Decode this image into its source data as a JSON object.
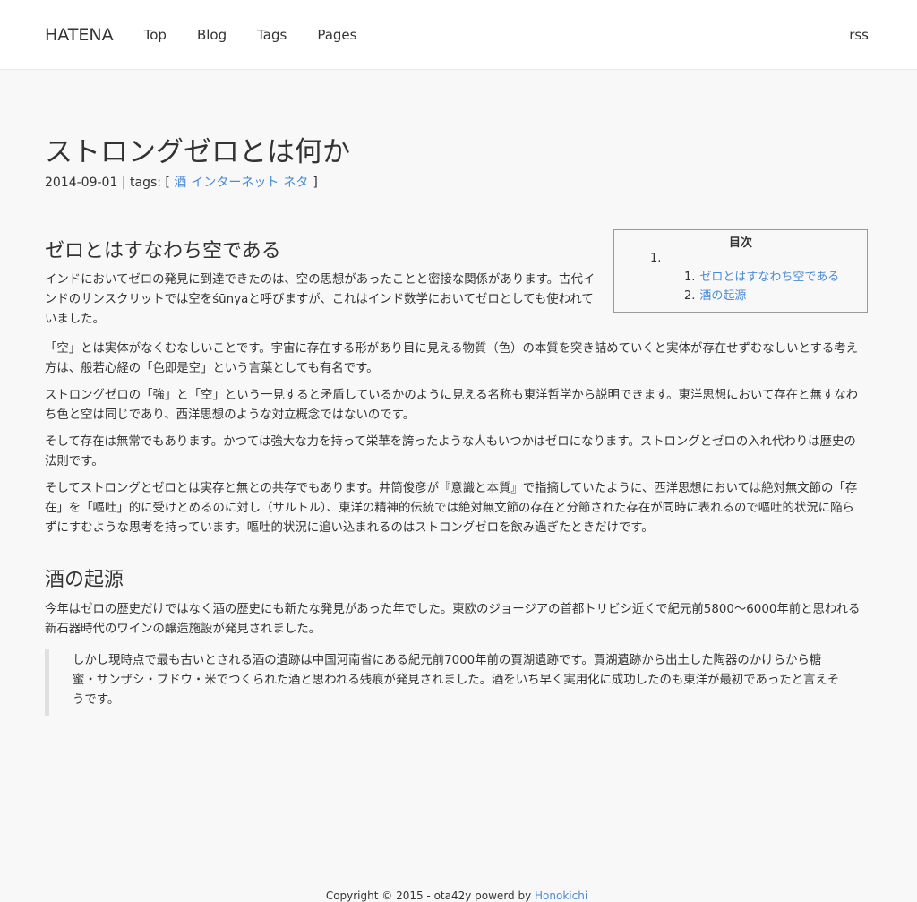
{
  "nav": {
    "brand": "HATENA",
    "items": [
      "Top",
      "Blog",
      "Tags",
      "Pages"
    ],
    "rss": "rss"
  },
  "post": {
    "title": "ストロングゼロとは何か",
    "date": "2014-09-01",
    "tags_prefix": "| tags: [",
    "tags": [
      "酒",
      "インターネット",
      "ネタ"
    ],
    "tags_suffix": "]"
  },
  "toc": {
    "heading": "目次",
    "outer_number": "1.",
    "items": [
      {
        "number": "1.",
        "label": "ゼロとはすなわち空である"
      },
      {
        "number": "2.",
        "label": "酒の起源"
      }
    ]
  },
  "sections": [
    {
      "heading": "ゼロとはすなわち空である",
      "paragraphs": [
        "インドにおいてゼロの発見に到達できたのは、空の思想があったことと密接な関係があります。古代インドのサンスクリットでは空をśūnyaと呼びますが、これはインド数学においてゼロとしても使われていました。",
        "「空」とは実体がなくむなしいことです。宇宙に存在する形があり目に見える物質（色）の本質を突き詰めていくと実体が存在せずむなしいとする考え方は、般若心経の「色即是空」という言葉としても有名です。",
        "ストロングゼロの「強」と「空」という一見すると矛盾しているかのように見える名称も東洋哲学から説明できます。東洋思想において存在と無すなわち色と空は同じであり、西洋思想のような対立概念ではないのです。",
        "そして存在は無常でもあります。かつては強大な力を持って栄華を誇ったような人もいつかはゼロになります。ストロングとゼロの入れ代わりは歴史の法則です。",
        "そしてストロングとゼロとは実存と無との共存でもあります。井筒俊彦が『意識と本質』で指摘していたように、西洋思想においては絶対無文節の「存在」を「嘔吐」的に受けとめるのに対し（サルトル）、東洋の精神的伝統では絶対無文節の存在と分節された存在が同時に表れるので嘔吐的状況に陥らずにすむような思考を持っています。嘔吐的状況に追い込まれるのはストロングゼロを飲み過ぎたときだけです。"
      ]
    },
    {
      "heading": "酒の起源",
      "paragraphs": [
        "今年はゼロの歴史だけではなく酒の歴史にも新たな発見があった年でした。東欧のジョージアの首都トリビシ近くで紀元前5800〜6000年前と思われる新石器時代のワインの醸造施設が発見されました。"
      ],
      "blockquote": "しかし現時点で最も古いとされる酒の遺跡は中国河南省にある紀元前7000年前の賈湖遺跡です。賈湖遺跡から出土した陶器のかけらから糖蜜・サンザシ・ブドウ・米でつくられた酒と思われる残痕が発見されました。酒をいち早く実用化に成功したのも東洋が最初であったと言えそうです。"
    }
  ],
  "footer": {
    "text": "Copyright © 2015 - ota42y powerd by",
    "link": "Honokichi"
  }
}
